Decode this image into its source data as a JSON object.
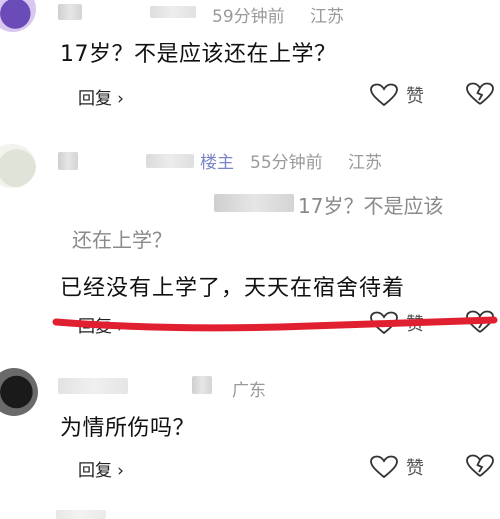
{
  "comments": [
    {
      "time": "59分钟前",
      "location": "江苏",
      "text": "17岁？不是应该还在上学？",
      "reply_label": "回复",
      "like_label": "赞"
    },
    {
      "author_badge": "楼主",
      "time": "55分钟前",
      "location": "江苏",
      "quote_line1": "17岁？不是应该",
      "quote_line2": "还在上学？",
      "text": "已经没有上学了，天天在宿舍待着",
      "reply_label": "回复",
      "like_label": "赞"
    },
    {
      "location": "广东",
      "text": "为情所伤吗？",
      "reply_label": "回复",
      "like_label": "赞"
    }
  ],
  "colors": {
    "underline": "#e02030",
    "meta": "#9a9a9a",
    "text": "#111111"
  },
  "icons": [
    "heart-icon",
    "broken-heart-icon",
    "chevron-right-icon"
  ]
}
